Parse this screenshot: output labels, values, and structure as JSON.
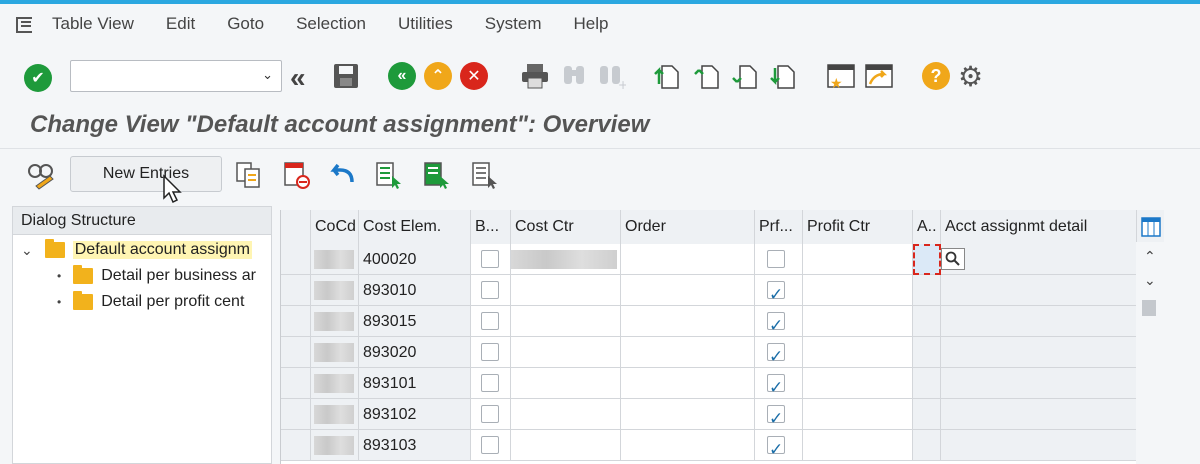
{
  "menu": [
    "Table View",
    "Edit",
    "Goto",
    "Selection",
    "Utilities",
    "System",
    "Help"
  ],
  "title": "Change View \"Default account assignment\": Overview",
  "buttons": {
    "new_entries": "New Entries"
  },
  "dialog": {
    "heading": "Dialog Structure",
    "items": [
      {
        "label": "Default account assignm",
        "level": 0,
        "selected": true
      },
      {
        "label": "Detail per business ar",
        "level": 1,
        "selected": false
      },
      {
        "label": "Detail per profit cent",
        "level": 1,
        "selected": false
      }
    ]
  },
  "table": {
    "headers": [
      "CoCd",
      "Cost Elem.",
      "B...",
      "Cost Ctr",
      "Order",
      "Prf...",
      "Profit Ctr",
      "A..",
      "Acct assignmt detail"
    ],
    "rows": [
      {
        "cost_elem": "400020",
        "prf": false
      },
      {
        "cost_elem": "893010",
        "prf": true
      },
      {
        "cost_elem": "893015",
        "prf": true
      },
      {
        "cost_elem": "893020",
        "prf": true
      },
      {
        "cost_elem": "893101",
        "prf": true
      },
      {
        "cost_elem": "893102",
        "prf": true
      },
      {
        "cost_elem": "893103",
        "prf": true
      }
    ]
  },
  "colors": {
    "accent": "#2aa7e0",
    "green": "#1e9a3b",
    "orange": "#f0a71a",
    "red": "#d9261c",
    "selection": "#fff5b3"
  }
}
